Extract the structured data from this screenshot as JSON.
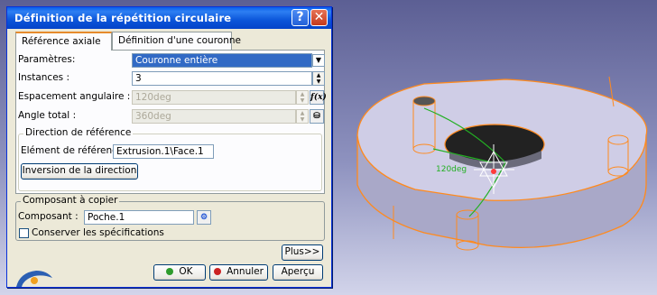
{
  "dialog": {
    "title": "Définition de la répétition circulaire",
    "help_label": "?",
    "close_label": "✕",
    "tabs": [
      {
        "label": "Référence axiale"
      },
      {
        "label": "Définition d'une couronne"
      }
    ],
    "params": {
      "parametres_label": "Paramètres:",
      "parametres_value": "Couronne entière",
      "instances_label": "Instances :",
      "instances_value": "3",
      "espacement_label": "Espacement angulaire :",
      "espacement_value": "120deg",
      "angle_label": "Angle total :",
      "angle_value": "360deg"
    },
    "direction": {
      "title": "Direction de référence",
      "element_label": "Elément de référence:",
      "element_value": "Extrusion.1\\Face.1",
      "inversion_button": "Inversion de la direction"
    },
    "composant": {
      "title": "Composant à copier",
      "composant_label": "Composant :",
      "composant_value": "Poche.1",
      "conserver_label": "Conserver les spécifications"
    },
    "plus_button": "Plus>>",
    "ok_button": "OK",
    "annuler_button": "Annuler",
    "apercu_button": "Aperçu"
  },
  "viewport": {
    "angle_annotation": "120deg"
  },
  "colors": {
    "accent_orange": "#ff8a1e",
    "ok_green": "#2e9b2e",
    "cancel_red": "#cc2222",
    "titlebar_blue": "#0b55d9"
  }
}
